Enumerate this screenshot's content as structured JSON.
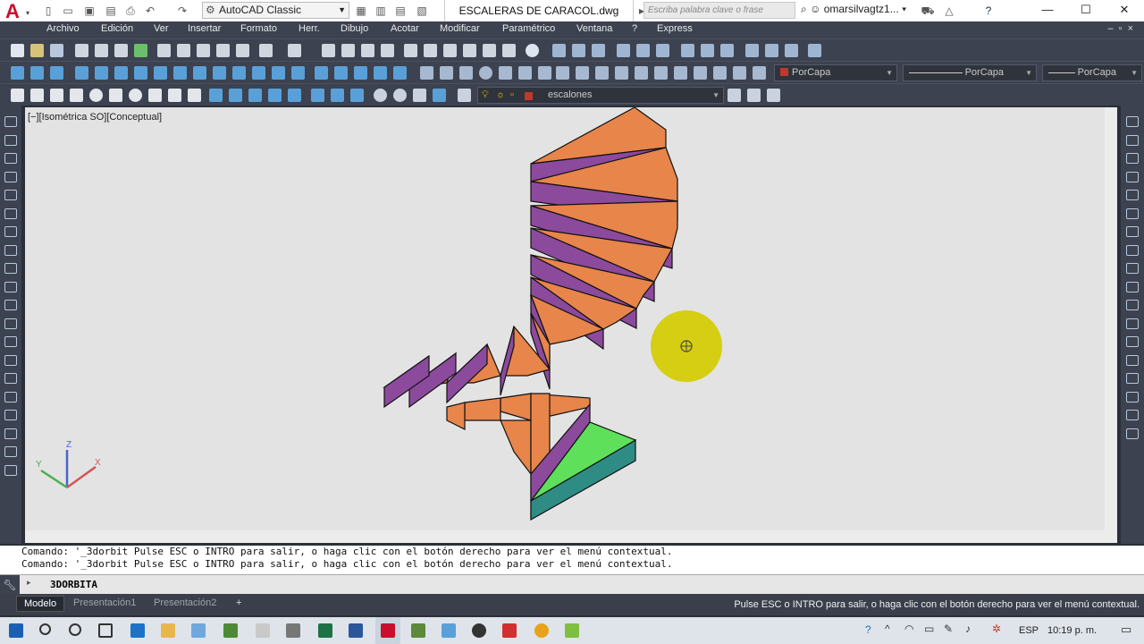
{
  "titlebar": {
    "workspace": "AutoCAD Classic",
    "document": "ESCALERAS DE CARACOL.dwg",
    "search_placeholder": "Escriba palabra clave o frase",
    "user": "omarsilvagtz1..."
  },
  "menu": [
    "Archivo",
    "Edición",
    "Ver",
    "Insertar",
    "Formato",
    "Herr.",
    "Dibujo",
    "Acotar",
    "Modificar",
    "Paramétrico",
    "Ventana",
    "?",
    "Express"
  ],
  "properties": {
    "color": "PorCapa",
    "linetype": "PorCapa",
    "lineweight": "PorCapa",
    "layer": "escalones"
  },
  "viewport": {
    "label": "[−][Isométrica SO][Conceptual]",
    "ucs_x": "X",
    "ucs_y": "Y",
    "ucs_z": "Z"
  },
  "command": {
    "history": [
      "Comando: '_3dorbit Pulse ESC o INTRO para salir, o haga clic con el botón derecho para ver el menú contextual.",
      "Comando: '_3dorbit Pulse ESC o INTRO para salir, o haga clic con el botón derecho para ver el menú contextual."
    ],
    "prompt_symbol": "▸",
    "input": "3DORBITA"
  },
  "layout_tabs": [
    "Modelo",
    "Presentación1",
    "Presentación2",
    "+"
  ],
  "status_message": "Pulse ESC o INTRO para salir, o haga clic con el botón derecho para ver el menú contextual.",
  "taskbar": {
    "language": "ESP",
    "time": "10:19 p. m."
  },
  "colors": {
    "step_top": "#e8854a",
    "step_side": "#8b4a9c",
    "landing_top": "#5ee05a",
    "landing_side": "#2e8c84",
    "orbit_cursor": "#d4cc00",
    "app_red": "#c8102e"
  }
}
